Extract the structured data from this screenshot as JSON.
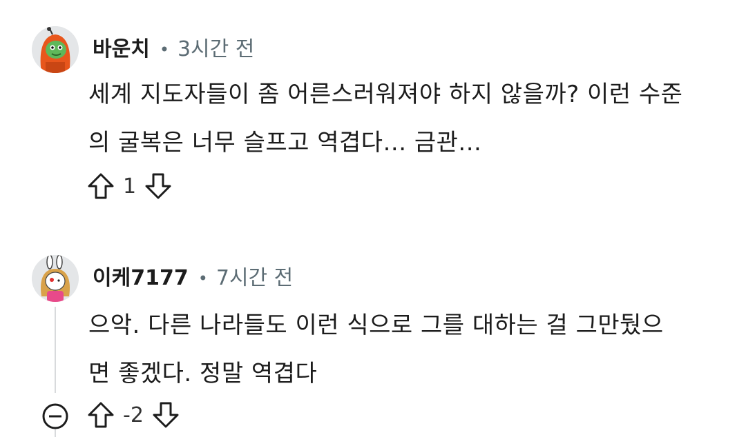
{
  "comments": [
    {
      "username": "바운치",
      "time": "3시간 전",
      "body_lines": [
        "세계 지도자들이 좀 어른스러워져야 하지 않을까? 이런 수준",
        "의 굴복은 너무 슬프고 역겹다... 금관..."
      ],
      "score": "1",
      "avatar_icon": "frog-hoodie-avatar-icon"
    },
    {
      "username": "이케7177",
      "time": "7시간 전",
      "body_lines": [
        "으악. 다른 나라들도 이런 식으로 그를 대하는 걸 그만뒀으",
        "면 좋겠다. 정말 역겹다"
      ],
      "score": "-2",
      "avatar_icon": "bunny-girl-avatar-icon"
    }
  ],
  "separator": "•",
  "colors": {
    "text": "#1c1c1c",
    "meta": "#5c6c74",
    "avatar_bg": "#e4e6e8",
    "thread_line": "#d8dadc"
  }
}
